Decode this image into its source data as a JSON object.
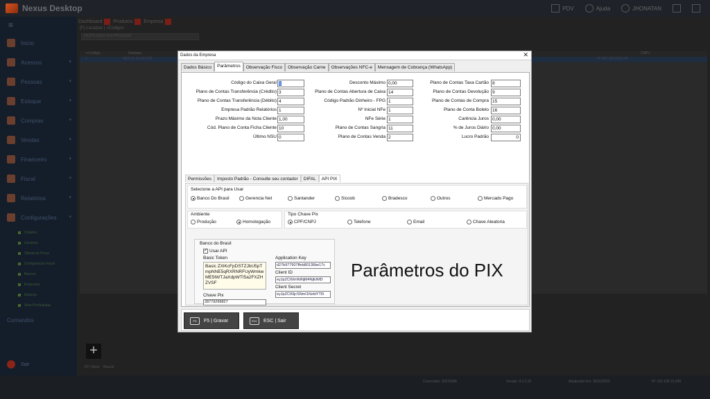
{
  "app": {
    "title": "Nexus Desktop",
    "pdv": "PDV",
    "help": "Ajuda",
    "user": "JHONATAN"
  },
  "sidebar": {
    "items": [
      {
        "label": "Início",
        "icon": "home-icon"
      },
      {
        "label": "Acessos",
        "icon": "key-icon"
      },
      {
        "label": "Pessoas",
        "icon": "people-icon"
      },
      {
        "label": "Estoque",
        "icon": "box-icon"
      },
      {
        "label": "Compras",
        "icon": "cart-icon"
      },
      {
        "label": "Vendas",
        "icon": "cash-icon"
      },
      {
        "label": "Financeiro",
        "icon": "money-icon"
      },
      {
        "label": "Fiscal",
        "icon": "document-icon"
      },
      {
        "label": "Relatórios",
        "icon": "report-icon"
      },
      {
        "label": "Configurações",
        "icon": "gear-icon"
      }
    ],
    "subitems": [
      "Cidades",
      "Usuários",
      "Tabela de Preço",
      "Configuração Fiscal",
      "Bancos",
      "Empresas",
      "Balança",
      "Área Privilegiada"
    ],
    "extra": "Comandos",
    "exit": "Sair"
  },
  "main": {
    "tabs": [
      "Dashboard",
      "Produtos",
      "Empresa"
    ],
    "breadcrumb": "(F) Localizar | <Código>",
    "filter_placeholder": "DIGITE AQUI SUA PESQUISA",
    "grid_headers": [
      "<<Código",
      "Fantasia",
      "CNPJ"
    ],
    "grid_row": [
      "1",
      "NEXUS DESKTOP",
      "00.000.000/0001-00"
    ],
    "add_label": "F2 | Novo",
    "search_label": "Buscar"
  },
  "status": {
    "left": "Conectado: SISTEMA",
    "version": "Versão: 4.2.2.32",
    "updated": "Atualizado Em: 30/11/2022",
    "ip": "IP: 192.168.15.245"
  },
  "dialog": {
    "title": "Dados da Empresa",
    "tabs": [
      "Dados Básico",
      "Parâmetros",
      "Observação Fisco",
      "Observação Carne",
      "Observações NFC-e",
      "Mensagem de Cobrança (WhatsApp)"
    ],
    "col1": [
      {
        "label": "Código do Caixa Geral",
        "value": "1"
      },
      {
        "label": "Plano de Contas Transferência (Crédito)",
        "value": "3"
      },
      {
        "label": "Plano de Contas Transferência (Débito)",
        "value": "4"
      },
      {
        "label": "Empresa Padrão Relatórios",
        "value": "1"
      },
      {
        "label": "Prazo Máximo da Nota Cliente",
        "value": "1,00"
      },
      {
        "label": "Cód. Plano de Conta Ficha Cliente",
        "value": "10"
      },
      {
        "label": "Último NSU",
        "value": "0"
      }
    ],
    "col2": [
      {
        "label": "Desconto Máximo",
        "value": "0,00"
      },
      {
        "label": "Plano de Contas Abertura de Caixa",
        "value": "14"
      },
      {
        "label": "Código Padrão Dinheiro - FPG",
        "value": "1"
      },
      {
        "label": "Nº Inicial NFe",
        "value": "1"
      },
      {
        "label": "NFe Série",
        "value": "1"
      },
      {
        "label": "Plano de Contas Sangria",
        "value": "11"
      },
      {
        "label": "Plano de Contas Venda",
        "value": "2"
      }
    ],
    "col3": [
      {
        "label": "Plano de Contas Taxa Cartão",
        "value": "8"
      },
      {
        "label": "Plano de Contas Devolução",
        "value": "9"
      },
      {
        "label": "Plano de Contas de Compra",
        "value": "15"
      },
      {
        "label": "Plano de Conta Boleto",
        "value": "16"
      },
      {
        "label": "Carência Juros",
        "value": "0,00"
      },
      {
        "label": "% de Juros Diário",
        "value": "0,00"
      },
      {
        "label": "Lucro Padrão",
        "value": "0"
      }
    ],
    "subtabs": [
      "Permissões",
      "Imposto Padrão - Consulte seu contador",
      "DIFAL",
      "API PIX"
    ],
    "api_group": "Selecione a API para Usar",
    "apis": [
      "Banco Do Brasil",
      "Gerencia Net",
      "Santander",
      "Sicoob",
      "Bradesco",
      "Outros",
      "Mercado Pago"
    ],
    "ambiente_title": "Ambiente",
    "ambientes": [
      "Produção",
      "Homologação"
    ],
    "tipo_title": "Tipo Chave Pix",
    "tipos": [
      "CPF/CNPJ",
      "Telefone",
      "Email",
      "Chave Aleatoria"
    ],
    "bb": {
      "title": "Banco do Brasil",
      "usar_api": "Usar API",
      "basic_token_label": "Basic Token",
      "basic_token": "Basic ZXlKcFpDSTZJbU5pTmpNNE5qRXRNRFUyWmkwME5tWTJaXdpWTI5a2FXZHZVSF",
      "chave_pix_label": "Chave Pix",
      "chave_pix": "28779299827",
      "app_key_label": "Application Key",
      "app_key": "d27b977907ffeb80136be17c",
      "client_id_label": "Client ID",
      "client_id": "eyJpZCI6ImNiNjM4NjEtMD",
      "client_secret_label": "Client Secret",
      "client_secret": "eyJpZCI6IjcSNmI1NzktYTI5"
    },
    "big_title": "Parâmetros do PIX",
    "buttons": [
      {
        "key": "F5",
        "label": "F5 | Gravar"
      },
      {
        "key": "Esc",
        "label": "ESC | Sair"
      }
    ]
  }
}
